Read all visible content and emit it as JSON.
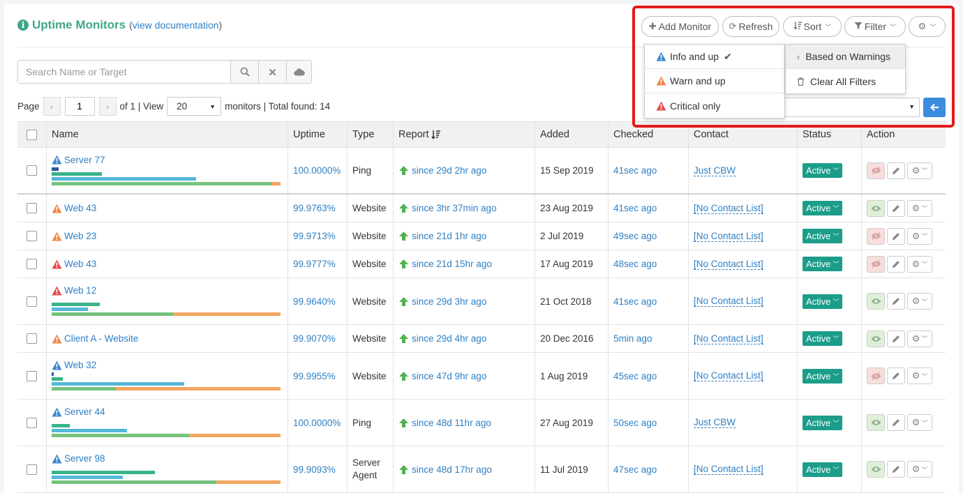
{
  "header": {
    "title": "Uptime Monitors",
    "doc_open": "(",
    "doc_link": "view documentation",
    "doc_close": ")",
    "info_icon": "info-circle-icon"
  },
  "toolbar": {
    "add_monitor": "Add Monitor",
    "refresh": "Refresh",
    "sort": "Sort",
    "filter": "Filter"
  },
  "search": {
    "placeholder": "Search Name or Target",
    "value": ""
  },
  "pager": {
    "page_label": "Page",
    "page_value": "1",
    "of_label": "of 1 | View",
    "view_value": "20",
    "suffix": "monitors | Total found: 14"
  },
  "filter_menu": {
    "items": [
      {
        "label": "Info and up",
        "level": "info",
        "checked": true
      },
      {
        "label": "Warn and up",
        "level": "warn",
        "checked": false
      },
      {
        "label": "Critical only",
        "level": "critical",
        "checked": false
      }
    ],
    "submenu": [
      {
        "label": "Based on Warnings",
        "icon": "chevron-left-icon",
        "active": true
      },
      {
        "label": "Clear All Filters",
        "icon": "trash-icon",
        "active": false
      }
    ]
  },
  "colors": {
    "accent": "#3fa68c",
    "link": "#2e7fc4",
    "status_active": "#1b9d8a",
    "warn_info": "#3b87d1",
    "warn_warn": "#f0874a",
    "warn_critical": "#e54b4b",
    "callout": "#e31b1b",
    "report_arrow": "#4fb34f"
  },
  "table": {
    "columns": [
      "Name",
      "Uptime",
      "Type",
      "Report",
      "Added",
      "Checked",
      "Contact",
      "Status",
      "Action"
    ],
    "rows": [
      {
        "name": "Server 77",
        "level": "info",
        "uptime": "100.0000%",
        "type": "Ping",
        "report": "since 29d 2hr ago",
        "added": "15 Sep 2019",
        "checked": "41sec ago",
        "contact": "Just CBW",
        "status": "Active",
        "eye": "off",
        "bars": [
          0.03,
          0.22,
          0.63,
          0.96
        ]
      },
      {
        "name": "Web 43",
        "level": "warn",
        "uptime": "99.9763%",
        "type": "Website",
        "report": "since 3hr 37min ago",
        "added": "23 Aug 2019",
        "checked": "41sec ago",
        "contact": "[No Contact List]",
        "status": "Active",
        "eye": "on",
        "bars": null
      },
      {
        "name": "Web 23",
        "level": "warn",
        "uptime": "99.9713%",
        "type": "Website",
        "report": "since 21d 1hr ago",
        "added": "2 Jul 2019",
        "checked": "49sec ago",
        "contact": "[No Contact List]",
        "status": "Active",
        "eye": "off",
        "bars": null
      },
      {
        "name": "Web 43",
        "level": "critical",
        "uptime": "99.9777%",
        "type": "Website",
        "report": "since 21d 15hr ago",
        "added": "17 Aug 2019",
        "checked": "48sec ago",
        "contact": "[No Contact List]",
        "status": "Active",
        "eye": "off",
        "bars": null
      },
      {
        "name": "Web 12",
        "level": "critical",
        "uptime": "99.9640%",
        "type": "Website",
        "report": "since 29d 3hr ago",
        "added": "21 Oct 2018",
        "checked": "41sec ago",
        "contact": "[No Contact List]",
        "status": "Active",
        "eye": "on",
        "bars": [
          0,
          0.21,
          0.16,
          0.53
        ]
      },
      {
        "name": "Client A - Website",
        "level": "warn",
        "uptime": "99.9070%",
        "type": "Website",
        "report": "since 29d 4hr ago",
        "added": "20 Dec 2016",
        "checked": "5min ago",
        "contact": "[No Contact List]",
        "status": "Active",
        "eye": "on",
        "bars": null
      },
      {
        "name": "Web 32",
        "level": "info",
        "uptime": "99.9955%",
        "type": "Website",
        "report": "since 47d 9hr ago",
        "added": "1 Aug 2019",
        "checked": "45sec ago",
        "contact": "[No Contact List]",
        "status": "Active",
        "eye": "off",
        "bars": [
          0.01,
          0.05,
          0.58,
          0.28
        ]
      },
      {
        "name": "Server 44",
        "level": "info",
        "uptime": "100.0000%",
        "type": "Ping",
        "report": "since 48d 11hr ago",
        "added": "27 Aug 2019",
        "checked": "50sec ago",
        "contact": "Just CBW",
        "status": "Active",
        "eye": "on",
        "bars": [
          0,
          0.08,
          0.33,
          0.6
        ]
      },
      {
        "name": "Server 98",
        "level": "info",
        "uptime": "99.9093%",
        "type": "Server Agent",
        "report": "since 48d 17hr ago",
        "added": "11 Jul 2019",
        "checked": "47sec ago",
        "contact": "[No Contact List]",
        "status": "Active",
        "eye": "on",
        "bars": [
          0,
          0.45,
          0.31,
          0.72
        ]
      }
    ]
  }
}
